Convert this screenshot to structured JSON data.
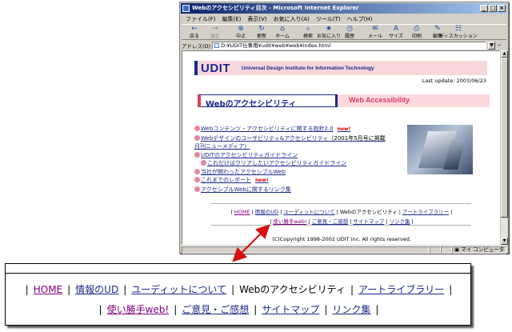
{
  "window": {
    "title": "Webのアクセシビリティ目次 - Microsoft Internet Explorer",
    "controls": [
      "_",
      "□",
      "×"
    ]
  },
  "menubar": [
    "ファイル(F)",
    "編集(E)",
    "表示(V)",
    "お気に入り(A)",
    "ツール(T)",
    "ヘルプ(H)"
  ],
  "toolbar": [
    {
      "label": "戻る",
      "icon": "back-arrow-icon",
      "glyph": "←",
      "disabled": false
    },
    {
      "label": "進む",
      "icon": "forward-arrow-icon",
      "glyph": "→",
      "disabled": true
    },
    {
      "label": "中止",
      "icon": "stop-icon",
      "glyph": "⊗",
      "disabled": false
    },
    {
      "label": "更新",
      "icon": "refresh-icon",
      "glyph": "↻",
      "disabled": false
    },
    {
      "label": "ホーム",
      "icon": "home-icon",
      "glyph": "⌂",
      "disabled": false
    },
    {
      "label": "検索",
      "icon": "search-icon",
      "glyph": "⌕",
      "disabled": false
    },
    {
      "label": "お気に入り",
      "icon": "favorites-icon",
      "glyph": "★",
      "disabled": false
    },
    {
      "label": "履歴",
      "icon": "history-icon",
      "glyph": "◷",
      "disabled": false
    },
    {
      "label": "メール",
      "icon": "mail-icon",
      "glyph": "✉",
      "disabled": false
    },
    {
      "label": "サイズ",
      "icon": "font-size-icon",
      "glyph": "A",
      "disabled": false
    },
    {
      "label": "印刷",
      "icon": "print-icon",
      "glyph": "⎙",
      "disabled": false
    },
    {
      "label": "編集",
      "icon": "edit-icon",
      "glyph": "✎",
      "disabled": false
    },
    {
      "label": "ディスカッション",
      "icon": "discuss-icon",
      "glyph": "☷",
      "disabled": false
    }
  ],
  "address": {
    "label": "アドレス(D)",
    "value": "D:¥UDIT仕事用¥udit¥web¥web¥index.html",
    "go": "移動"
  },
  "status": {
    "left": "",
    "zone": "マイ コンピュータ"
  },
  "page": {
    "logo": "UDIT",
    "logo_sub": "Universal Design Institute for Information Technology",
    "last_update": "Last update: 2003/06/23",
    "banner_jp": "Webのアクセシビリティ",
    "banner_en": "Web Accessibility",
    "menu": [
      {
        "text": "Webコンテンツ・アクセシビリティに関する指針2.0",
        "new": "new!",
        "sub": false
      },
      {
        "text": "Webデザインのユーザビリティ&アクセシビリティ",
        "suffix": "（2001年5月号に掲載",
        "sub": false
      },
      {
        "text": "月刊ニューメディア）",
        "continuation": true
      },
      {
        "text": "UDITのアクセシビリティガイドライン",
        "sub": false
      },
      {
        "text": "これだけはクリアしたいアクセシビリティガイドライン",
        "sub": true
      },
      {
        "text": "当社が関わったアクセシブルWeb",
        "sub": false
      },
      {
        "text": "これまでのレポート",
        "new": "new!",
        "sub": false
      },
      {
        "text": "アクセシブルWebに関するリンク集",
        "sub": false
      }
    ],
    "copyright": "(C)Copyright 1998-2002 UDIT Inc. All rights reserved."
  },
  "footer_nav": {
    "row1": [
      "HOME",
      "情報のUD",
      "ユーディットについて",
      "Webのアクセシビリティ",
      "アートライブラリー"
    ],
    "row2": [
      "使い勝手web!",
      "ご意見・ご感想",
      "サイトマップ",
      "リンク集"
    ],
    "current": "Webのアクセシビリティ",
    "visited": [
      "HOME",
      "使い勝手web!"
    ],
    "separator": "|"
  }
}
